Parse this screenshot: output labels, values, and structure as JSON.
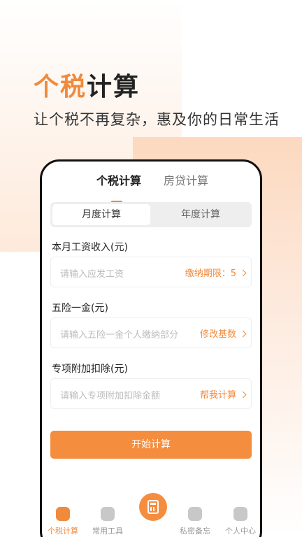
{
  "hero": {
    "title_highlight": "个税",
    "title_rest": "计算",
    "subtitle": "让个税不再复杂，惠及你的日常生活"
  },
  "tabs": [
    {
      "label": "个税计算"
    },
    {
      "label": "房贷计算"
    }
  ],
  "segment": {
    "monthly": "月度计算",
    "yearly": "年度计算"
  },
  "fields": {
    "salary": {
      "label": "本月工资收入(元)",
      "placeholder": "请输入应发工资",
      "action": "缴纳期限：5"
    },
    "insurance": {
      "label": "五险一金(元)",
      "placeholder": "请输入五险一金个人缴纳部分",
      "action": "修改基数"
    },
    "deduction": {
      "label": "专项附加扣除(元)",
      "placeholder": "请输入专项附加扣除金额",
      "action": "帮我计算"
    }
  },
  "start_button": "开始计算",
  "tabbar": [
    {
      "label": "个税计算",
      "icon": "tax-icon"
    },
    {
      "label": "常用工具",
      "icon": "grid-icon"
    },
    {
      "label": "私密备忘",
      "icon": "memo-icon"
    },
    {
      "label": "个人中心",
      "icon": "user-icon"
    }
  ],
  "colors": {
    "accent": "#f08a3c",
    "button": "#f58d3f"
  }
}
